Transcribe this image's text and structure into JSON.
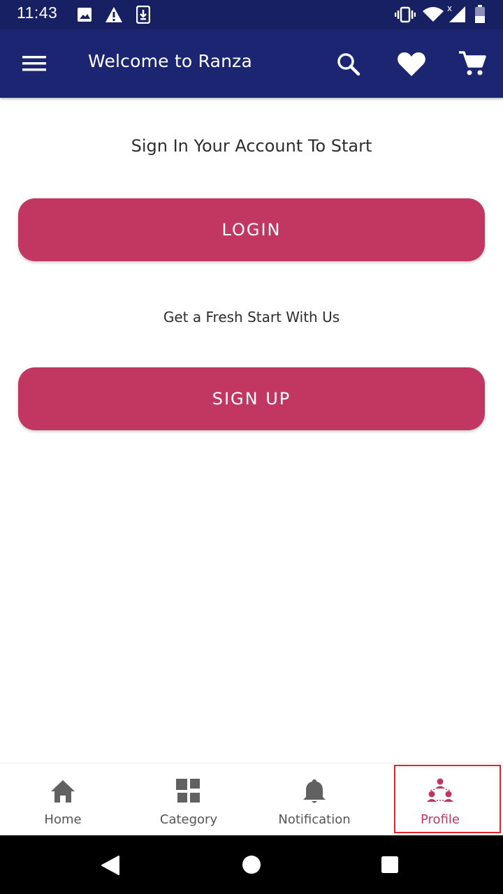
{
  "status_bar": {
    "time": "11:43",
    "icons": [
      "image-icon",
      "warning-icon",
      "download-icon",
      "vibrate-icon",
      "wifi-icon",
      "signal-icon",
      "battery-icon"
    ],
    "color": "#172063"
  },
  "app_bar": {
    "title": "Welcome to Ranza",
    "icons": [
      "menu-icon",
      "search-icon",
      "heart-icon",
      "cart-icon"
    ],
    "color": "#1b2572"
  },
  "main": {
    "sign_in_heading": "Sign In Your Account To Start",
    "login_label": "LOGIN",
    "fresh_start_text": "Get a Fresh Start With Us",
    "signup_label": "SIGN UP",
    "accent_color": "#c23762"
  },
  "bottom_nav": {
    "items": [
      {
        "label": "Home",
        "icon": "home-icon",
        "active": false
      },
      {
        "label": "Category",
        "icon": "category-icon",
        "active": false
      },
      {
        "label": "Notification",
        "icon": "bell-icon",
        "active": false
      },
      {
        "label": "Profile",
        "icon": "profile-icon",
        "active": true
      }
    ]
  },
  "system_nav": {
    "icons": [
      "back-icon",
      "home-circle-icon",
      "recents-icon"
    ]
  }
}
